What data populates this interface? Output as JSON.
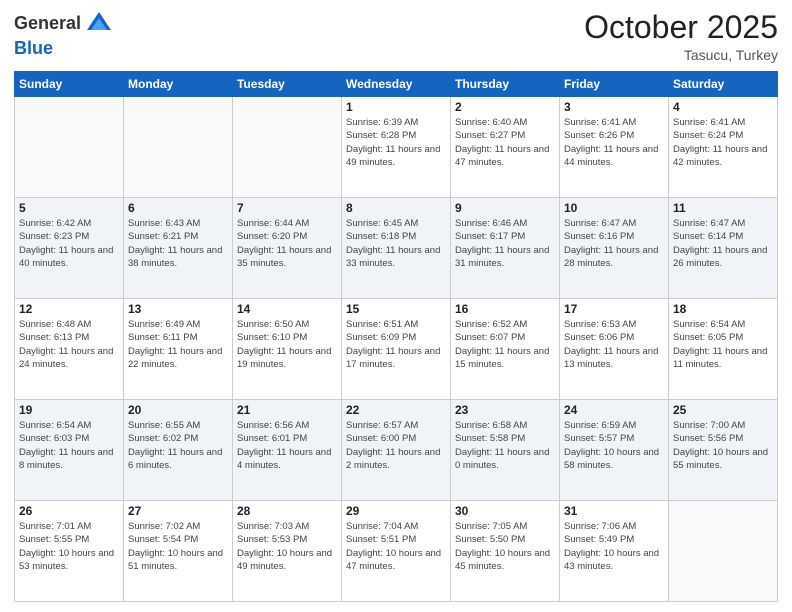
{
  "header": {
    "logo_line1": "General",
    "logo_line2": "Blue",
    "month": "October 2025",
    "location": "Tasucu, Turkey"
  },
  "days_of_week": [
    "Sunday",
    "Monday",
    "Tuesday",
    "Wednesday",
    "Thursday",
    "Friday",
    "Saturday"
  ],
  "weeks": [
    [
      {
        "day": "",
        "info": ""
      },
      {
        "day": "",
        "info": ""
      },
      {
        "day": "",
        "info": ""
      },
      {
        "day": "1",
        "info": "Sunrise: 6:39 AM\nSunset: 6:28 PM\nDaylight: 11 hours and 49 minutes."
      },
      {
        "day": "2",
        "info": "Sunrise: 6:40 AM\nSunset: 6:27 PM\nDaylight: 11 hours and 47 minutes."
      },
      {
        "day": "3",
        "info": "Sunrise: 6:41 AM\nSunset: 6:26 PM\nDaylight: 11 hours and 44 minutes."
      },
      {
        "day": "4",
        "info": "Sunrise: 6:41 AM\nSunset: 6:24 PM\nDaylight: 11 hours and 42 minutes."
      }
    ],
    [
      {
        "day": "5",
        "info": "Sunrise: 6:42 AM\nSunset: 6:23 PM\nDaylight: 11 hours and 40 minutes."
      },
      {
        "day": "6",
        "info": "Sunrise: 6:43 AM\nSunset: 6:21 PM\nDaylight: 11 hours and 38 minutes."
      },
      {
        "day": "7",
        "info": "Sunrise: 6:44 AM\nSunset: 6:20 PM\nDaylight: 11 hours and 35 minutes."
      },
      {
        "day": "8",
        "info": "Sunrise: 6:45 AM\nSunset: 6:18 PM\nDaylight: 11 hours and 33 minutes."
      },
      {
        "day": "9",
        "info": "Sunrise: 6:46 AM\nSunset: 6:17 PM\nDaylight: 11 hours and 31 minutes."
      },
      {
        "day": "10",
        "info": "Sunrise: 6:47 AM\nSunset: 6:16 PM\nDaylight: 11 hours and 28 minutes."
      },
      {
        "day": "11",
        "info": "Sunrise: 6:47 AM\nSunset: 6:14 PM\nDaylight: 11 hours and 26 minutes."
      }
    ],
    [
      {
        "day": "12",
        "info": "Sunrise: 6:48 AM\nSunset: 6:13 PM\nDaylight: 11 hours and 24 minutes."
      },
      {
        "day": "13",
        "info": "Sunrise: 6:49 AM\nSunset: 6:11 PM\nDaylight: 11 hours and 22 minutes."
      },
      {
        "day": "14",
        "info": "Sunrise: 6:50 AM\nSunset: 6:10 PM\nDaylight: 11 hours and 19 minutes."
      },
      {
        "day": "15",
        "info": "Sunrise: 6:51 AM\nSunset: 6:09 PM\nDaylight: 11 hours and 17 minutes."
      },
      {
        "day": "16",
        "info": "Sunrise: 6:52 AM\nSunset: 6:07 PM\nDaylight: 11 hours and 15 minutes."
      },
      {
        "day": "17",
        "info": "Sunrise: 6:53 AM\nSunset: 6:06 PM\nDaylight: 11 hours and 13 minutes."
      },
      {
        "day": "18",
        "info": "Sunrise: 6:54 AM\nSunset: 6:05 PM\nDaylight: 11 hours and 11 minutes."
      }
    ],
    [
      {
        "day": "19",
        "info": "Sunrise: 6:54 AM\nSunset: 6:03 PM\nDaylight: 11 hours and 8 minutes."
      },
      {
        "day": "20",
        "info": "Sunrise: 6:55 AM\nSunset: 6:02 PM\nDaylight: 11 hours and 6 minutes."
      },
      {
        "day": "21",
        "info": "Sunrise: 6:56 AM\nSunset: 6:01 PM\nDaylight: 11 hours and 4 minutes."
      },
      {
        "day": "22",
        "info": "Sunrise: 6:57 AM\nSunset: 6:00 PM\nDaylight: 11 hours and 2 minutes."
      },
      {
        "day": "23",
        "info": "Sunrise: 6:58 AM\nSunset: 5:58 PM\nDaylight: 11 hours and 0 minutes."
      },
      {
        "day": "24",
        "info": "Sunrise: 6:59 AM\nSunset: 5:57 PM\nDaylight: 10 hours and 58 minutes."
      },
      {
        "day": "25",
        "info": "Sunrise: 7:00 AM\nSunset: 5:56 PM\nDaylight: 10 hours and 55 minutes."
      }
    ],
    [
      {
        "day": "26",
        "info": "Sunrise: 7:01 AM\nSunset: 5:55 PM\nDaylight: 10 hours and 53 minutes."
      },
      {
        "day": "27",
        "info": "Sunrise: 7:02 AM\nSunset: 5:54 PM\nDaylight: 10 hours and 51 minutes."
      },
      {
        "day": "28",
        "info": "Sunrise: 7:03 AM\nSunset: 5:53 PM\nDaylight: 10 hours and 49 minutes."
      },
      {
        "day": "29",
        "info": "Sunrise: 7:04 AM\nSunset: 5:51 PM\nDaylight: 10 hours and 47 minutes."
      },
      {
        "day": "30",
        "info": "Sunrise: 7:05 AM\nSunset: 5:50 PM\nDaylight: 10 hours and 45 minutes."
      },
      {
        "day": "31",
        "info": "Sunrise: 7:06 AM\nSunset: 5:49 PM\nDaylight: 10 hours and 43 minutes."
      },
      {
        "day": "",
        "info": ""
      }
    ]
  ]
}
